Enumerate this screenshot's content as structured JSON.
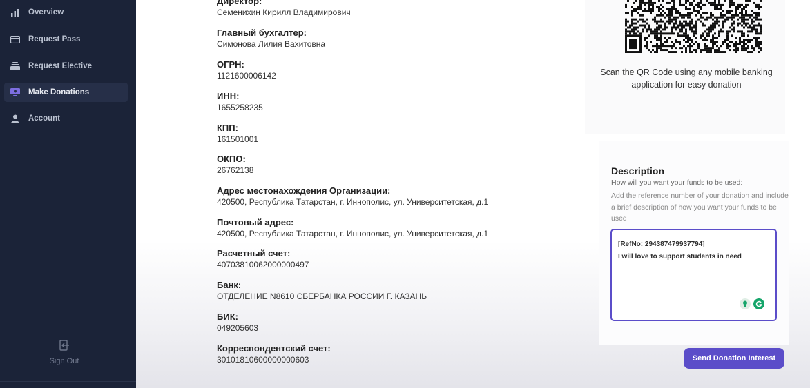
{
  "sidebar": {
    "items": [
      {
        "label": "Overview",
        "icon": "bar-chart-icon"
      },
      {
        "label": "Request Pass",
        "icon": "card-icon"
      },
      {
        "label": "Request Elective",
        "icon": "stack-icon"
      },
      {
        "label": "Make Donations",
        "icon": "monitor-icon"
      },
      {
        "label": "Account",
        "icon": "user-icon"
      }
    ],
    "active": "Make Donations",
    "signout_label": "Sign Out"
  },
  "details": [
    {
      "label": "Директор:",
      "value": "Семенихин Кирилл Владимирович"
    },
    {
      "label": "Главный бухгалтер:",
      "value": "Симонова Лилия Вахитовна"
    },
    {
      "label": "ОГРН:",
      "value": "1121600006142"
    },
    {
      "label": "ИНН:",
      "value": "1655258235"
    },
    {
      "label": "КПП:",
      "value": "161501001"
    },
    {
      "label": "ОКПО:",
      "value": "26762138"
    },
    {
      "label": "Адрес местонахождения Организации:",
      "value": "420500, Республика Татарстан, г. Иннополис, ул. Университетская, д.1"
    },
    {
      "label": "Почтовый адрес:",
      "value": "420500, Республика Татарстан, г. Иннополис, ул. Университетская, д.1"
    },
    {
      "label": "Расчетный счет:",
      "value": "40703810062000000497"
    },
    {
      "label": "Банк:",
      "value": "ОТДЕЛЕНИЕ N8610 СБЕРБАНКА РОССИИ Г. КАЗАНЬ"
    },
    {
      "label": "БИК:",
      "value": "049205603"
    },
    {
      "label": "Корреспондентский счет:",
      "value": "30101810600000000603"
    }
  ],
  "qr": {
    "text": "Scan the QR Code using any mobile banking application for easy donation"
  },
  "description": {
    "title": "Description",
    "subtitle": "How will you want your funds to be used:",
    "help": "Add the reference number of your donation and include a brief description of how you want your funds to be used",
    "ref_line": "[RefNo: 294387479937794]",
    "message_line": "I will love to support students in need"
  },
  "send_button": "Send Donation Interest",
  "colors": {
    "sidebar_bg": "#1b2338",
    "accent": "#5b4dc9"
  }
}
